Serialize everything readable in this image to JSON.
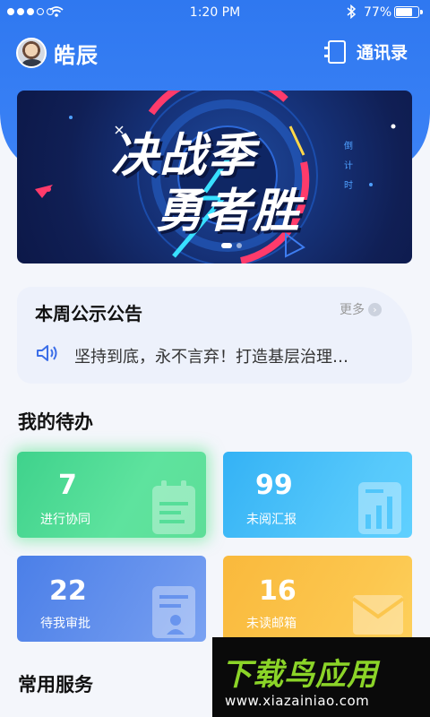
{
  "status_bar": {
    "time": "1:20 PM",
    "battery": "77%",
    "battery_level": 0.77,
    "icons": [
      "signal-dots-icon",
      "wifi-icon",
      "bluetooth-icon",
      "battery-icon"
    ]
  },
  "header": {
    "user_name": "皓辰",
    "contacts_label": "通讯录",
    "contacts_icon": "address-book-icon"
  },
  "banner": {
    "line1": "决战季",
    "line2": "勇者胜",
    "vertical_text": "倒计时",
    "page_count": 2,
    "active_page": 1
  },
  "notice": {
    "title": "本周公示公告",
    "more_label": "更多",
    "text": "坚持到底，永不言弃！打造基层治理…",
    "icon": "speaker-icon"
  },
  "todo": {
    "title": "我的待办",
    "cards": [
      {
        "count": "7",
        "label": "进行协同",
        "color": "#4cd994",
        "icon": "clipboard-icon"
      },
      {
        "count": "99",
        "label": "未阅汇报",
        "color": "#45c0f8",
        "icon": "report-chart-icon"
      },
      {
        "count": "22",
        "label": "待我审批",
        "color": "#5c8bea",
        "icon": "approval-doc-icon"
      },
      {
        "count": "16",
        "label": "未读邮箱",
        "color": "#fbc145",
        "icon": "envelope-icon"
      }
    ]
  },
  "services": {
    "title": "常用服务"
  },
  "watermark": {
    "main": "下载鸟应用",
    "url": "www.xiazainiao.com"
  }
}
